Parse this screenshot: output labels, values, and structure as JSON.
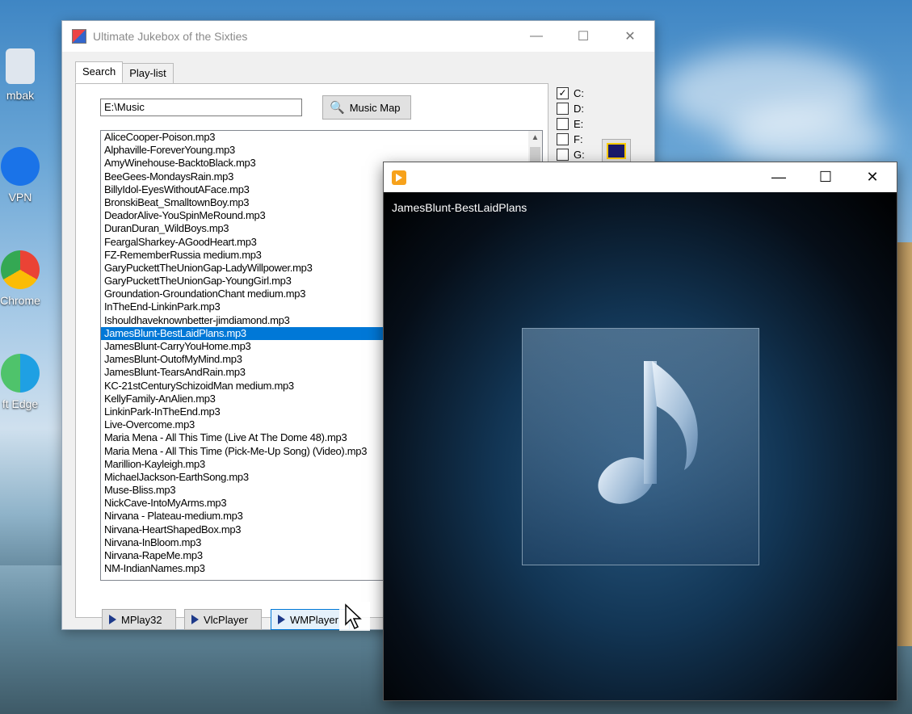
{
  "desktop": {
    "icons": [
      {
        "label": "mbak",
        "icon": "recycle-bin-icon"
      },
      {
        "label": "VPN",
        "icon": "vpn-icon"
      },
      {
        "label": "Chrome",
        "icon": "chrome-icon"
      },
      {
        "label": "ft Edge",
        "icon": "edge-icon"
      }
    ]
  },
  "jukebox": {
    "title": "Ultimate Jukebox of the Sixties",
    "tabs": [
      {
        "label": "Search"
      },
      {
        "label": "Play-list"
      }
    ],
    "path_value": "E:\\Music",
    "music_map_label": "Music Map",
    "drives": [
      {
        "label": "C:",
        "checked": true
      },
      {
        "label": "D:",
        "checked": false
      },
      {
        "label": "E:",
        "checked": false
      },
      {
        "label": "F:",
        "checked": false
      },
      {
        "label": "G:",
        "checked": false
      }
    ],
    "files": [
      "AliceCooper-Poison.mp3",
      "Alphaville-ForeverYoung.mp3",
      "AmyWinehouse-BacktoBlack.mp3",
      "BeeGees-MondaysRain.mp3",
      "BillyIdol-EyesWithoutAFace.mp3",
      "BronskiBeat_SmalltownBoy.mp3",
      "DeadorAlive-YouSpinMeRound.mp3",
      "DuranDuran_WildBoys.mp3",
      "FeargalSharkey-AGoodHeart.mp3",
      "FZ-RememberRussia medium.mp3",
      "GaryPuckettTheUnionGap-LadyWillpower.mp3",
      "GaryPuckettTheUnionGap-YoungGirl.mp3",
      "Groundation-GroundationChant medium.mp3",
      "InTheEnd-LinkinPark.mp3",
      "Ishouldhaveknownbetter-jimdiamond.mp3",
      "JamesBlunt-BestLaidPlans.mp3",
      "JamesBlunt-CarryYouHome.mp3",
      "JamesBlunt-OutofMyMind.mp3",
      "JamesBlunt-TearsAndRain.mp3",
      "KC-21stCenturySchizoidMan medium.mp3",
      "KellyFamily-AnAlien.mp3",
      "LinkinPark-InTheEnd.mp3",
      "Live-Overcome.mp3",
      "Maria Mena - All This Time (Live At The Dome 48).mp3",
      "Maria Mena - All This Time (Pick-Me-Up Song) (Video).mp3",
      "Marillion-Kayleigh.mp3",
      "MichaelJackson-EarthSong.mp3",
      "Muse-Bliss.mp3",
      "NickCave-IntoMyArms.mp3",
      "Nirvana - Plateau-medium.mp3",
      "Nirvana-HeartShapedBox.mp3",
      "Nirvana-InBloom.mp3",
      "Nirvana-RapeMe.mp3",
      "NM-IndianNames.mp3"
    ],
    "selected_file": "JamesBlunt-BestLaidPlans.mp3",
    "player_buttons": [
      {
        "label": "MPlay32"
      },
      {
        "label": "VlcPlayer"
      },
      {
        "label": "WMPlayer"
      }
    ]
  },
  "media_player": {
    "track_title": "JamesBlunt-BestLaidPlans",
    "icon": "media-player-icon"
  },
  "colors": {
    "selection": "#0078d7",
    "player_accent": "#f7a21b"
  }
}
